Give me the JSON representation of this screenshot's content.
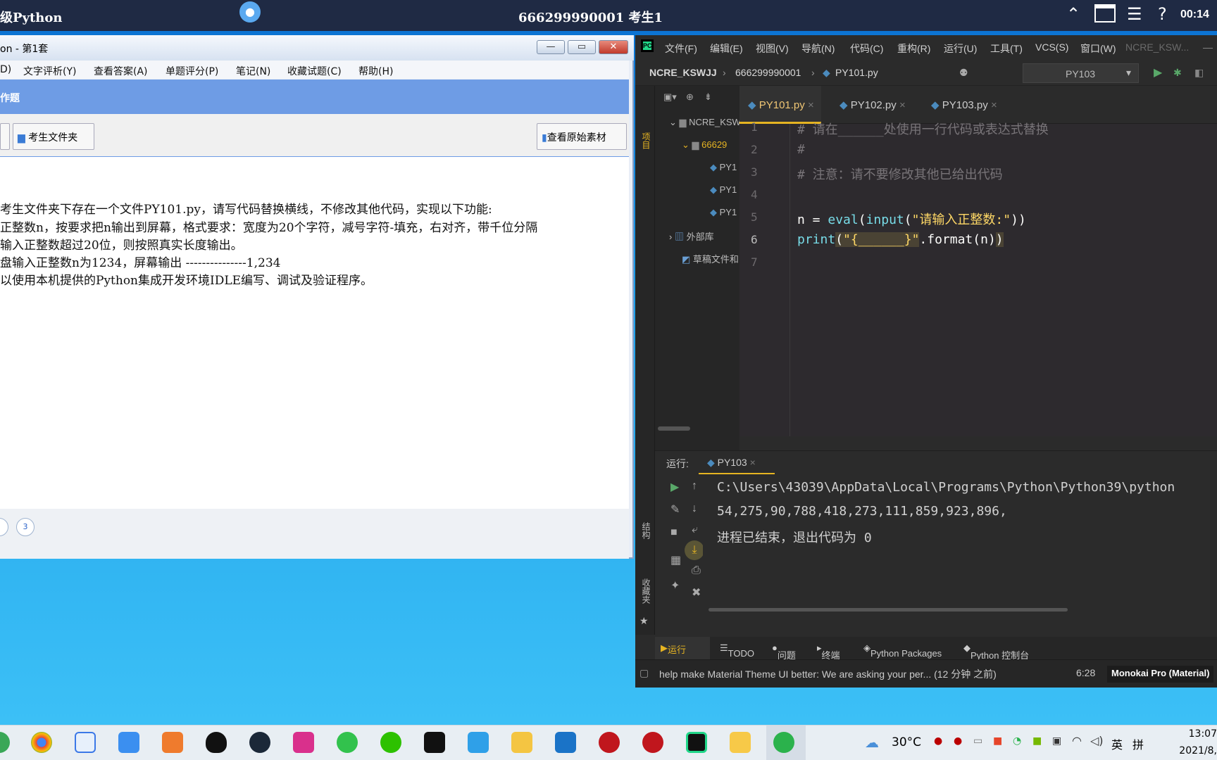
{
  "exam_bar": {
    "left_title": "级Python",
    "center": "666299990001  考生1",
    "time": "00:14"
  },
  "exam_window": {
    "title": "on - 第1套",
    "menu": [
      "D)",
      "文字评析(Y)",
      "查看答案(A)",
      "单题评分(P)",
      "笔记(N)",
      "收藏试题(C)",
      "帮助(H)"
    ],
    "band_title": "作题",
    "btn_folder": "考生文件夹",
    "btn_material": "查看原始素材",
    "lines": [
      "考生文件夹下存在一个文件PY101.py，请写代码替换横线，不修改其他代码，实现以下功能:",
      "正整数n，按要求把n输出到屏幕，格式要求：宽度为20个字符，减号字符-填充，右对齐，带千位分隔",
      "输入正整数超过20位，则按照真实长度输出。",
      "盘输入正整数n为1234，屏幕输出 ---------------1,234",
      "以使用本机提供的Python集成开发环境IDLE编写、调试及验证程序。"
    ],
    "page_current": "3"
  },
  "pycharm": {
    "menu": [
      "文件(F)",
      "编辑(E)",
      "视图(V)",
      "导航(N)",
      "代码(C)",
      "重构(R)",
      "运行(U)",
      "工具(T)",
      "VCS(S)",
      "窗口(W)",
      "NCRE_KSW..."
    ],
    "breadcrumbs": [
      "NCRE_KSWJJ",
      "666299990001",
      "PY101.py"
    ],
    "run_config": "PY103",
    "project_side_label": "项目",
    "structure_label": "结构",
    "favorites_label": "收藏夹",
    "tree": {
      "root": "NCRE_KSW",
      "folder": "66629",
      "files": [
        "PY1",
        "PY1",
        "PY1"
      ],
      "ext_lib": "外部库",
      "scratch": "草稿文件和"
    },
    "tabs": [
      "PY101.py",
      "PY102.py",
      "PY103.py"
    ],
    "code": {
      "line_numbers": [
        "1",
        "2",
        "3",
        "4",
        "5",
        "6",
        "7"
      ],
      "l1": "# 请在______处使用一行代码或表达式替换",
      "l2": "#",
      "l3": "# 注意：请不要修改其他已给出代码",
      "l5_a": "n = ",
      "l5_fn": "eval",
      "l5_b": "(",
      "l5_fn2": "input",
      "l5_c": "(",
      "l5_str": "\"请输入正整数:\"",
      "l5_d": "))",
      "l6_fn": "print",
      "l6_a": "(",
      "l6_str": "\"{______}\"",
      "l6_b": ".format(n)",
      "l6_c": ")"
    },
    "run": {
      "label": "运行:",
      "tab": "PY103",
      "out1": "C:\\Users\\43039\\AppData\\Local\\Programs\\Python\\Python39\\python",
      "out2": "54,275,90,788,418,273,111,859,923,896,",
      "out3": "进程已结束，退出代码为 0"
    },
    "bottom_tabs": [
      "运行",
      "TODO",
      "问题",
      "终端",
      "Python Packages",
      "Python 控制台"
    ],
    "status_msg": "help make Material Theme UI better: We are asking your per... (12 分钟 之前)",
    "status_pos": "6:28",
    "status_theme": "Monokai Pro (Material)"
  },
  "taskbar": {
    "weather": "30°C",
    "ime1": "英",
    "ime2": "拼",
    "clock_time": "13:07",
    "clock_date": "2021/8,"
  },
  "colors": {
    "accent": "#e6b422",
    "band": "#6e9ce5",
    "editor_bg": "#2d2a2e"
  }
}
